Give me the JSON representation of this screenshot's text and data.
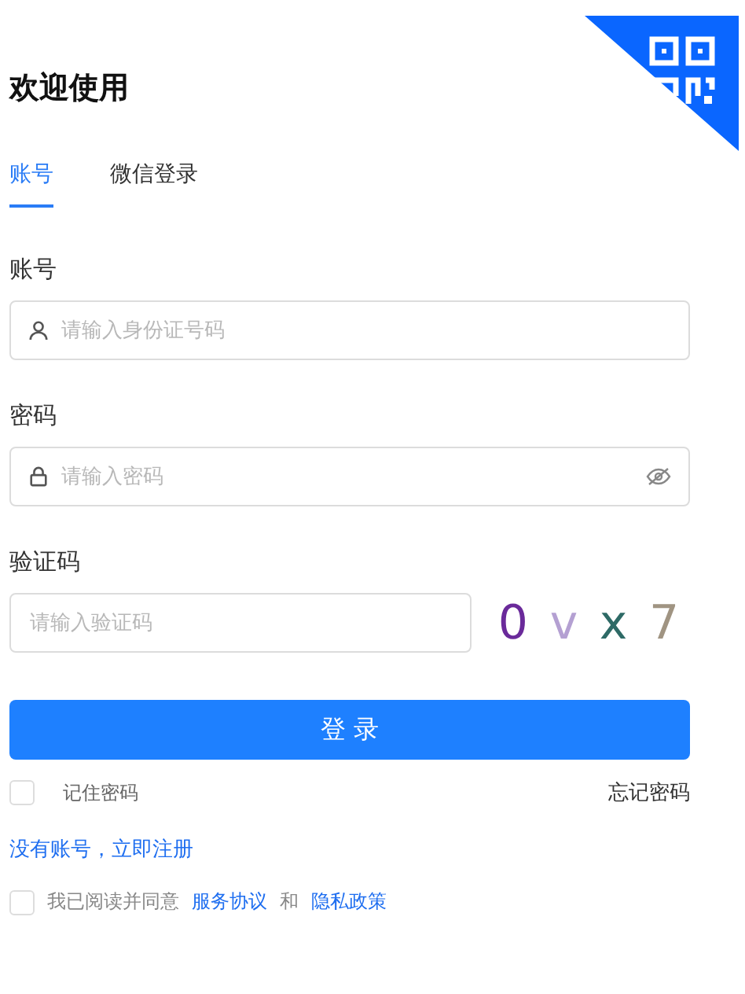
{
  "title": "欢迎使用",
  "tabs": [
    {
      "label": "账号",
      "selected": true
    },
    {
      "label": "微信登录",
      "selected": false
    }
  ],
  "fields": [
    {
      "kind": "user",
      "label": "账号",
      "placeholder": "请输入身份证号码"
    },
    {
      "kind": "password",
      "label": "密码",
      "placeholder": "请输入密码"
    },
    {
      "kind": "captcha",
      "label": "验证码",
      "placeholder": "请输入验证码"
    }
  ],
  "captcha": [
    {
      "char": "0",
      "color": "#6a2a9a"
    },
    {
      "char": "v",
      "color": "#b4a0d2"
    },
    {
      "char": "x",
      "color": "#2e6a66"
    },
    {
      "char": "7",
      "color": "#a09482"
    }
  ],
  "login_button": "登 录",
  "remember": {
    "label": "记住密码",
    "checked": false
  },
  "forgot": "忘记密码",
  "register": "没有账号，立即注册",
  "agreement": {
    "checked": false,
    "text": "我已阅读并同意",
    "link1": "服务协议",
    "joiner": "和",
    "link2": "隐私政策"
  }
}
